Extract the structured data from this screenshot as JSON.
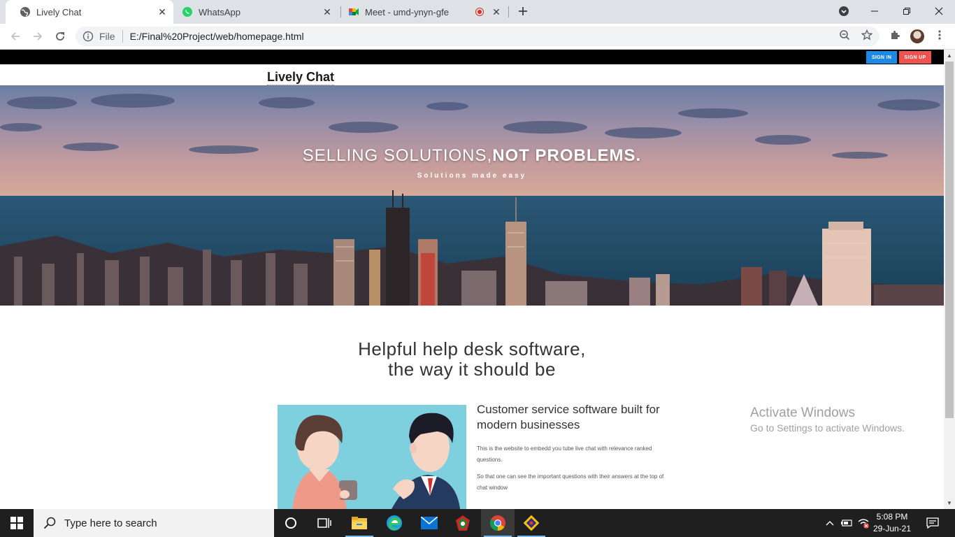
{
  "browser": {
    "tabs": [
      {
        "label": "Lively Chat",
        "icon": "globe-icon",
        "active": true
      },
      {
        "label": "WhatsApp",
        "icon": "whatsapp-icon",
        "active": false
      },
      {
        "label": "Meet - umd-ynyn-gfe",
        "icon": "google-meet-icon",
        "active": false,
        "recording": true
      }
    ],
    "address": {
      "scheme_label": "File",
      "url": "E:/Final%20Project/web/homepage.html"
    }
  },
  "page": {
    "auth": {
      "sign_in": "SIGN IN",
      "sign_up": "SIGN UP"
    },
    "brand": "Lively Chat",
    "hero": {
      "title_part1": "SELLING SOLUTIONS,",
      "title_part2": "NOT PROBLEMS.",
      "subtitle": "Solutions made easy"
    },
    "section": {
      "heading_line1": "Helpful help desk software,",
      "heading_line2": "the way it should be"
    },
    "feature": {
      "title": "Customer service software built for modern businesses",
      "paragraph1": "This is the website to embedd you tube live chat with relevance ranked questions.",
      "paragraph2": "So that one can see the important questions with their answers at the top of chat window"
    }
  },
  "watermark": {
    "line1": "Activate Windows",
    "line2": "Go to Settings to activate Windows."
  },
  "taskbar": {
    "search_placeholder": "Type here to search",
    "time": "5:08 PM",
    "date": "29-Jun-21"
  },
  "colors": {
    "sign_in_bg": "#1e88e5",
    "sign_up_bg": "#ef5350",
    "top_bar": "#000000",
    "illustration_bg": "#7fd0df"
  }
}
